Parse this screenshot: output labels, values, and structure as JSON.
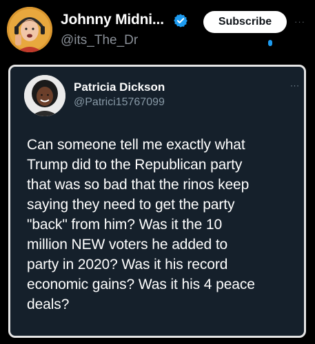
{
  "author": {
    "display_name": "Johnny Midni...",
    "handle": "@its_The_Dr",
    "verified": true
  },
  "actions": {
    "subscribe_label": "Subscribe",
    "more_label": "···"
  },
  "quoted_tweet": {
    "display_name": "Patricia Dickson",
    "handle": "@Patrici15767099",
    "more_label": "···",
    "text": "Can someone tell me exactly what\nTrump did to the Republican party\nthat was so bad that the rinos keep\nsaying they need to get the party\n\"back\" from him? Was it the 10\nmillion NEW voters he added to\nparty in 2020? Was it his record\neconomic gains? Was it his 4 peace\ndeals?"
  },
  "colors": {
    "page_background": "#000000",
    "card_background": "#15202b",
    "card_border": "#e6e6e6",
    "verified_blue": "#1d9bf0",
    "secondary_text": "#8b9199"
  },
  "icons": {
    "verified": "verified-badge-icon",
    "more": "more-options-icon"
  }
}
